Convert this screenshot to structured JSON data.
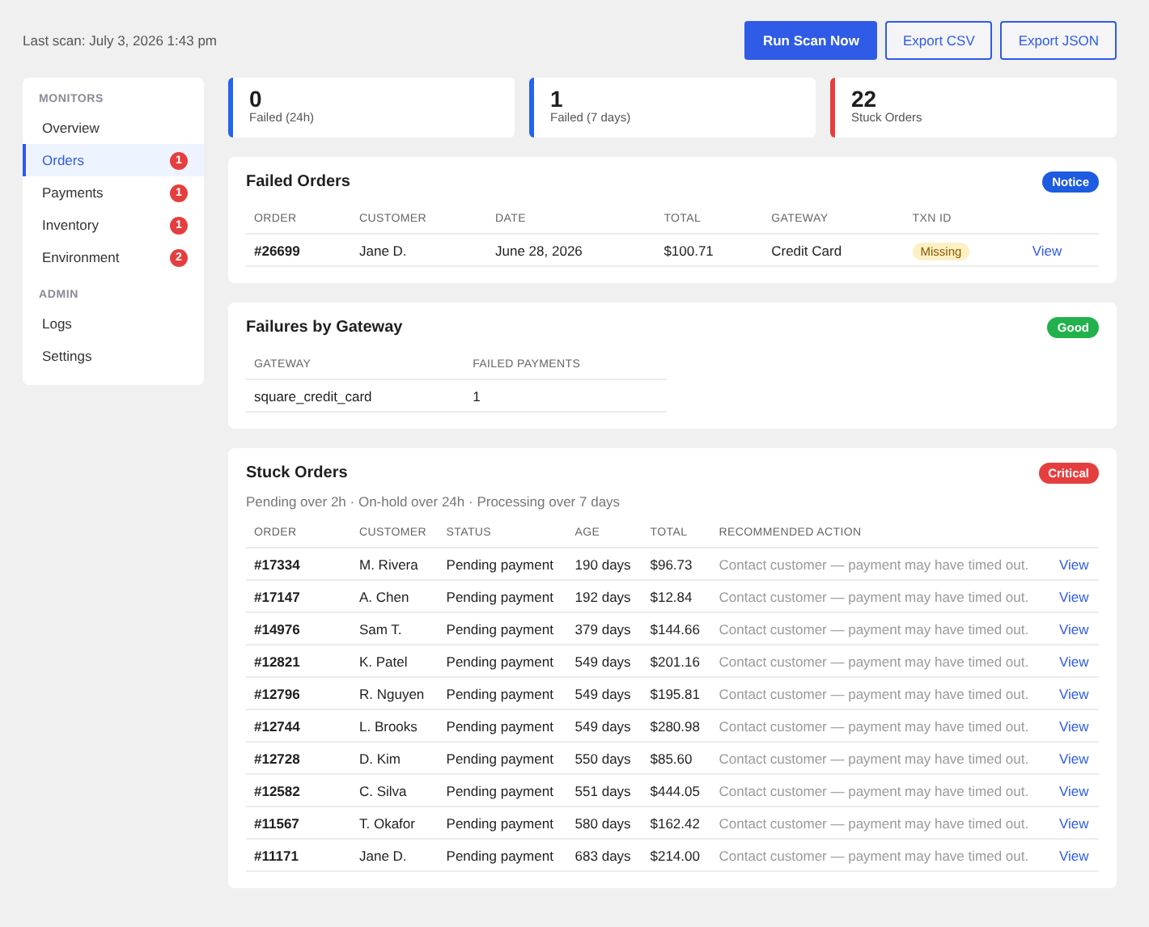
{
  "header": {
    "last_scan": "Last scan: July 3, 2026 1:43 pm",
    "buttons": [
      {
        "label": "Run Scan Now",
        "kind": "primary"
      },
      {
        "label": "Export CSV",
        "kind": "outline"
      },
      {
        "label": "Export JSON",
        "kind": "outline"
      }
    ]
  },
  "sidebar": {
    "sections": [
      {
        "heading": "MONITORS",
        "items": [
          {
            "label": "Overview",
            "selected": false
          },
          {
            "label": "Orders",
            "selected": true,
            "badge": "1"
          },
          {
            "label": "Payments",
            "selected": false,
            "badge": "1"
          },
          {
            "label": "Inventory",
            "selected": false,
            "badge": "1"
          },
          {
            "label": "Environment",
            "selected": false,
            "badge": "2"
          }
        ]
      },
      {
        "heading": "ADMIN",
        "items": [
          {
            "label": "Logs",
            "selected": false
          },
          {
            "label": "Settings",
            "selected": false
          }
        ]
      }
    ]
  },
  "stats": [
    {
      "value": "0",
      "label": "Failed (24h)",
      "color": "#2563eb"
    },
    {
      "value": "1",
      "label": "Failed (7 days)",
      "color": "#2563eb"
    },
    {
      "value": "22",
      "label": "Stuck Orders",
      "color": "#e53e3e"
    }
  ],
  "panels": [
    {
      "title": "Failed Orders",
      "status": {
        "label": "Notice",
        "color": "#1d5be0"
      },
      "table": {
        "columns": [
          "ORDER",
          "CUSTOMER",
          "DATE",
          "TOTAL",
          "GATEWAY",
          "TXN ID",
          ""
        ],
        "rows": [
          [
            "#26699",
            "Jane D.",
            "June 28, 2026",
            "$100.71",
            "Credit Card",
            {
              "tag": "Missing"
            },
            {
              "link": "View"
            }
          ]
        ]
      }
    },
    {
      "title": "Failures by Gateway",
      "status": {
        "label": "Good",
        "color": "#22b14c"
      },
      "table": {
        "columns": [
          "GATEWAY",
          "FAILED PAYMENTS"
        ],
        "rows": [
          [
            "square_credit_card",
            "1"
          ]
        ]
      }
    },
    {
      "title": "Stuck Orders",
      "status": {
        "label": "Critical",
        "color": "#e53e3e"
      },
      "subtitle": "Pending over 2h · On-hold over 24h · Processing over 7 days",
      "table": {
        "columns": [
          "ORDER",
          "CUSTOMER",
          "STATUS",
          "AGE",
          "TOTAL",
          "RECOMMENDED ACTION",
          ""
        ],
        "rows": [
          [
            "#17334",
            "M. Rivera",
            "Pending payment",
            "190 days",
            "$96.73",
            {
              "note": "Contact customer — payment may have timed out."
            },
            {
              "link": "View"
            }
          ],
          [
            "#17147",
            "A. Chen",
            "Pending payment",
            "192 days",
            "$12.84",
            {
              "note": "Contact customer — payment may have timed out."
            },
            {
              "link": "View"
            }
          ],
          [
            "#14976",
            "Sam T.",
            "Pending payment",
            "379 days",
            "$144.66",
            {
              "note": "Contact customer — payment may have timed out."
            },
            {
              "link": "View"
            }
          ],
          [
            "#12821",
            "K. Patel",
            "Pending payment",
            "549 days",
            "$201.16",
            {
              "note": "Contact customer — payment may have timed out."
            },
            {
              "link": "View"
            }
          ],
          [
            "#12796",
            "R. Nguyen",
            "Pending payment",
            "549 days",
            "$195.81",
            {
              "note": "Contact customer — payment may have timed out."
            },
            {
              "link": "View"
            }
          ],
          [
            "#12744",
            "L. Brooks",
            "Pending payment",
            "549 days",
            "$280.98",
            {
              "note": "Contact customer — payment may have timed out."
            },
            {
              "link": "View"
            }
          ],
          [
            "#12728",
            "D. Kim",
            "Pending payment",
            "550 days",
            "$85.60",
            {
              "note": "Contact customer — payment may have timed out."
            },
            {
              "link": "View"
            }
          ],
          [
            "#12582",
            "C. Silva",
            "Pending payment",
            "551 days",
            "$444.05",
            {
              "note": "Contact customer — payment may have timed out."
            },
            {
              "link": "View"
            }
          ],
          [
            "#11567",
            "T. Okafor",
            "Pending payment",
            "580 days",
            "$162.42",
            {
              "note": "Contact customer — payment may have timed out."
            },
            {
              "link": "View"
            }
          ],
          [
            "#11171",
            "Jane D.",
            "Pending payment",
            "683 days",
            "$214.00",
            {
              "note": "Contact customer — payment may have timed out."
            },
            {
              "link": "View"
            }
          ]
        ]
      }
    }
  ]
}
